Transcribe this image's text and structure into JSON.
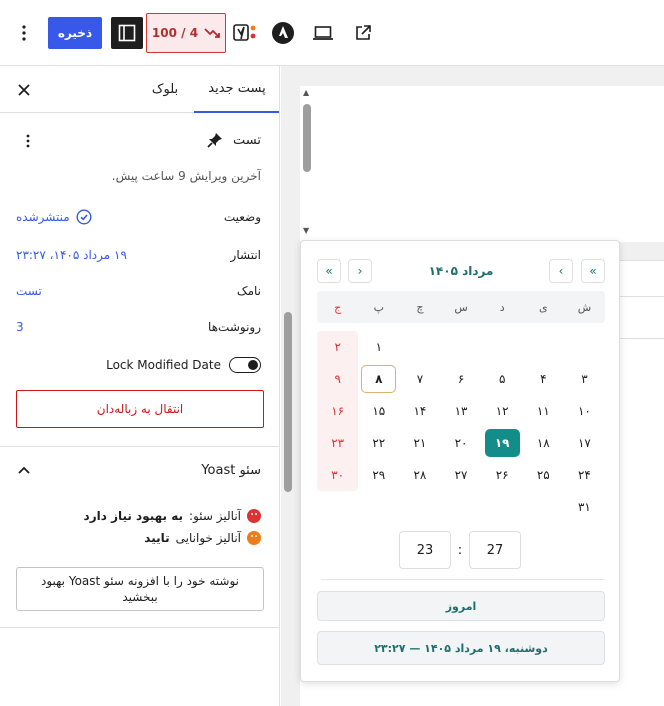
{
  "toolbar": {
    "save_label": "ذخیره",
    "seo_score": "100 / 4"
  },
  "sidebar": {
    "tabs": [
      {
        "label": "پست جدید",
        "active": true
      },
      {
        "label": "بلوک",
        "active": false
      }
    ],
    "post_title": "تست",
    "last_edited": "آخرین ویرایش 9 ساعت پیش.",
    "meta": {
      "status_label": "وضعیت",
      "status_value": "منتشرشده",
      "publish_label": "انتشار",
      "publish_value": "۱۹ مرداد ۱۴۰۵، ۲۳:۲۷",
      "slug_label": "نامک",
      "slug_value": "تست",
      "revisions_label": "رونوشت‌ها",
      "revisions_value": "3"
    },
    "lock_modified_label": "Lock Modified Date",
    "lock_modified_on": true,
    "trash_label": "انتقال به زباله‌دان",
    "yoast": {
      "title": "سئو Yoast",
      "seo_analysis_prefix": "آنالیز سئو:",
      "seo_analysis_value": "به بهبود نیاز دارد",
      "readability_prefix": "آنالیز خوانایی",
      "readability_value": "تایید",
      "improve_button": "نوشته خود را با افزونه سئو Yoast بهبود ببخشید"
    }
  },
  "datepicker": {
    "month_title": "مرداد ۱۴۰۵",
    "weekdays": [
      "ش",
      "ی",
      "د",
      "س",
      "چ",
      "پ",
      "ج"
    ],
    "weeks": [
      [
        "",
        "",
        "",
        "",
        "",
        "۱",
        "۲"
      ],
      [
        "۳",
        "۴",
        "۵",
        "۶",
        "۷",
        "۸",
        "۹"
      ],
      [
        "۱۰",
        "۱۱",
        "۱۲",
        "۱۳",
        "۱۴",
        "۱۵",
        "۱۶"
      ],
      [
        "۱۷",
        "۱۸",
        "۱۹",
        "۲۰",
        "۲۱",
        "۲۲",
        "۲۳"
      ],
      [
        "۲۴",
        "۲۵",
        "۲۶",
        "۲۷",
        "۲۸",
        "۲۹",
        "۳۰"
      ],
      [
        "۳۱",
        "",
        "",
        "",
        "",
        "",
        ""
      ]
    ],
    "selected_day": "۸",
    "today_day": "۱۹",
    "hour": "23",
    "minute": "27",
    "time_separator": ":",
    "today_label": "امروز",
    "full_date": "دوشنبه، ۱۹ مرداد ۱۴۰۵ — ۲۳:۲۷",
    "colors": {
      "accent": "#138d8a",
      "friday": "#d63638",
      "selected_border": "#d7b271"
    }
  },
  "colors": {
    "primary": "#3858e9",
    "danger": "#cc1818"
  }
}
